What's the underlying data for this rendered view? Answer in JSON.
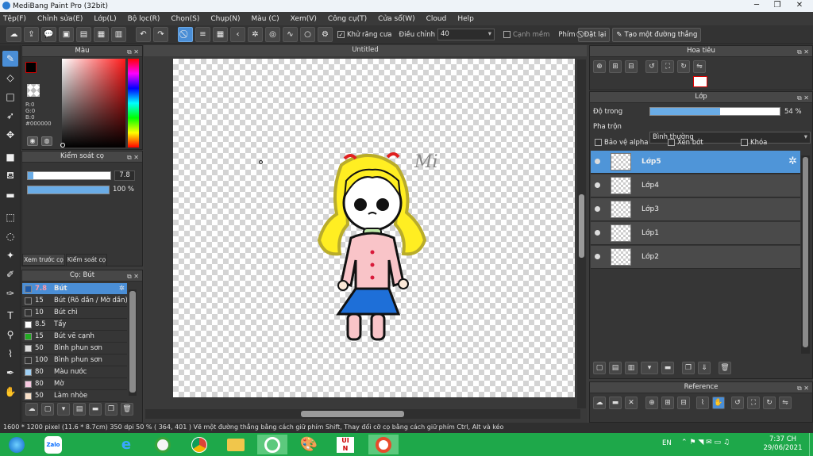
{
  "window": {
    "title": "MediBang Paint Pro (32bit)"
  },
  "menu": [
    "Tệp(F)",
    "Chỉnh sửa(E)",
    "Lớp(L)",
    "Bộ lọc(R)",
    "Chọn(S)",
    "Chụp(N)",
    "Màu (C)",
    "Xem(V)",
    "Công cụ(T)",
    "Cửa sổ(W)",
    "Cloud",
    "Help"
  ],
  "toolbar": {
    "antialias_label": "Khử răng cưa",
    "adjust_label": "Điều chỉnh",
    "adjust_value": "40",
    "edge_label": "Cạnh mềm",
    "key_label": "Phím",
    "reset_label": "Đặt lại",
    "line_label": "Tạo một đường thẳng"
  },
  "color_panel": {
    "title": "Màu",
    "r": "R:0",
    "g": "G:0",
    "b": "B:0",
    "hex": "#000000",
    "primary_color": "#000000",
    "secondary_color": "#ffffff"
  },
  "brush_control": {
    "title": "Kiểm soát cọ",
    "size": "7.8",
    "opacity": "100 %",
    "size_fraction": 0.07,
    "opacity_fraction": 1.0,
    "tab_preview": "Xem trước cọ",
    "tab_control": "Kiểm soát cọ"
  },
  "brush_list": {
    "title": "Cọ: Bút",
    "items": [
      {
        "size": "7.8",
        "name": "Bút",
        "swatch": "#1e5aa8",
        "selected": true
      },
      {
        "size": "15",
        "name": "Bút (Rõ dần / Mờ dần)",
        "swatch": "#333333"
      },
      {
        "size": "10",
        "name": "Bút chì",
        "swatch": "#333333"
      },
      {
        "size": "8.5",
        "name": "Tẩy",
        "swatch": "#ffffff"
      },
      {
        "size": "15",
        "name": "Bút vẽ cạnh",
        "swatch": "#22aa22"
      },
      {
        "size": "50",
        "name": "Bình phun sơn",
        "swatch": "#dddddd"
      },
      {
        "size": "100",
        "name": "Bình phun sơn",
        "swatch": "#333333"
      },
      {
        "size": "80",
        "name": "Màu nước",
        "swatch": "#9fd0f5"
      },
      {
        "size": "80",
        "name": "Mờ",
        "swatch": "#f6c8e0"
      },
      {
        "size": "50",
        "name": "Làm nhòe",
        "swatch": "#f8e0c8"
      }
    ]
  },
  "canvas": {
    "tab_title": "Untitled",
    "signature": "Mi"
  },
  "navigator": {
    "title": "Hoa tiêu"
  },
  "layer_panel": {
    "title": "Lớp",
    "opacity_label": "Độ trong",
    "opacity_value": "54 %",
    "opacity_fraction": 0.54,
    "blend_label": "Pha trộn",
    "blend_value": "Bình thường",
    "protect_alpha": "Bảo vệ alpha",
    "clipping": "Xén bớt",
    "lock": "Khóa",
    "layers": [
      {
        "name": "Lớp5",
        "selected": true
      },
      {
        "name": "Lớp4"
      },
      {
        "name": "Lớp3"
      },
      {
        "name": "Lớp1"
      },
      {
        "name": "Lớp2"
      }
    ]
  },
  "reference": {
    "title": "Reference"
  },
  "status": {
    "text": "1600 * 1200 pixel   (11.6 * 8.7cm)   350 dpi   50 %   ( 364, 401 )   Vẽ một đường thẳng bằng cách giữ phím Shift, Thay đổi cỡ cọ bằng cách giữ phím Ctrl, Alt và kéo"
  },
  "taskbar": {
    "lang": "EN",
    "time": "7:37 CH",
    "date": "29/06/2021",
    "zalo": "Zalo"
  }
}
